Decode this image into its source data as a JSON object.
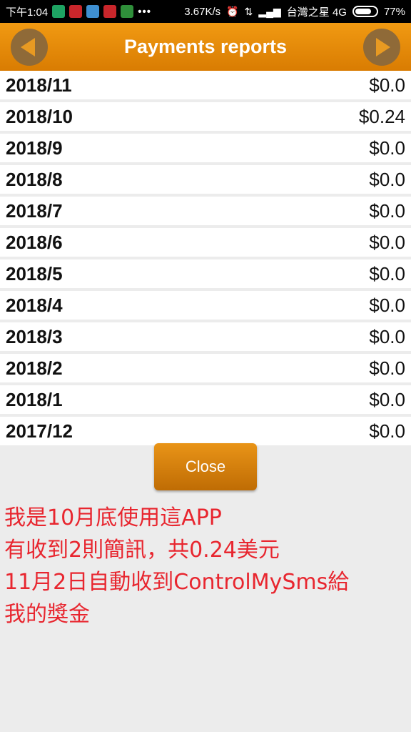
{
  "status_bar": {
    "time": "下午1:04",
    "speed": "3.67K/s",
    "carrier": "台灣之星 4G",
    "battery": "77%",
    "battery_level": 0.77
  },
  "header": {
    "title": "Payments reports"
  },
  "reports": [
    {
      "month": "2018/11",
      "amount": "$0.0"
    },
    {
      "month": "2018/10",
      "amount": "$0.24"
    },
    {
      "month": "2018/9",
      "amount": "$0.0"
    },
    {
      "month": "2018/8",
      "amount": "$0.0"
    },
    {
      "month": "2018/7",
      "amount": "$0.0"
    },
    {
      "month": "2018/6",
      "amount": "$0.0"
    },
    {
      "month": "2018/5",
      "amount": "$0.0"
    },
    {
      "month": "2018/4",
      "amount": "$0.0"
    },
    {
      "month": "2018/3",
      "amount": "$0.0"
    },
    {
      "month": "2018/2",
      "amount": "$0.0"
    },
    {
      "month": "2018/1",
      "amount": "$0.0"
    },
    {
      "month": "2017/12",
      "amount": "$0.0"
    }
  ],
  "close_label": "Close",
  "note_lines": [
    "我是10月底使用這APP",
    "有收到2則簡訊，共0.24美元",
    "11月2日自動收到ControlMySms給",
    "我的獎金"
  ],
  "colors": {
    "header": "#e88c0a",
    "note": "#e8262f"
  }
}
